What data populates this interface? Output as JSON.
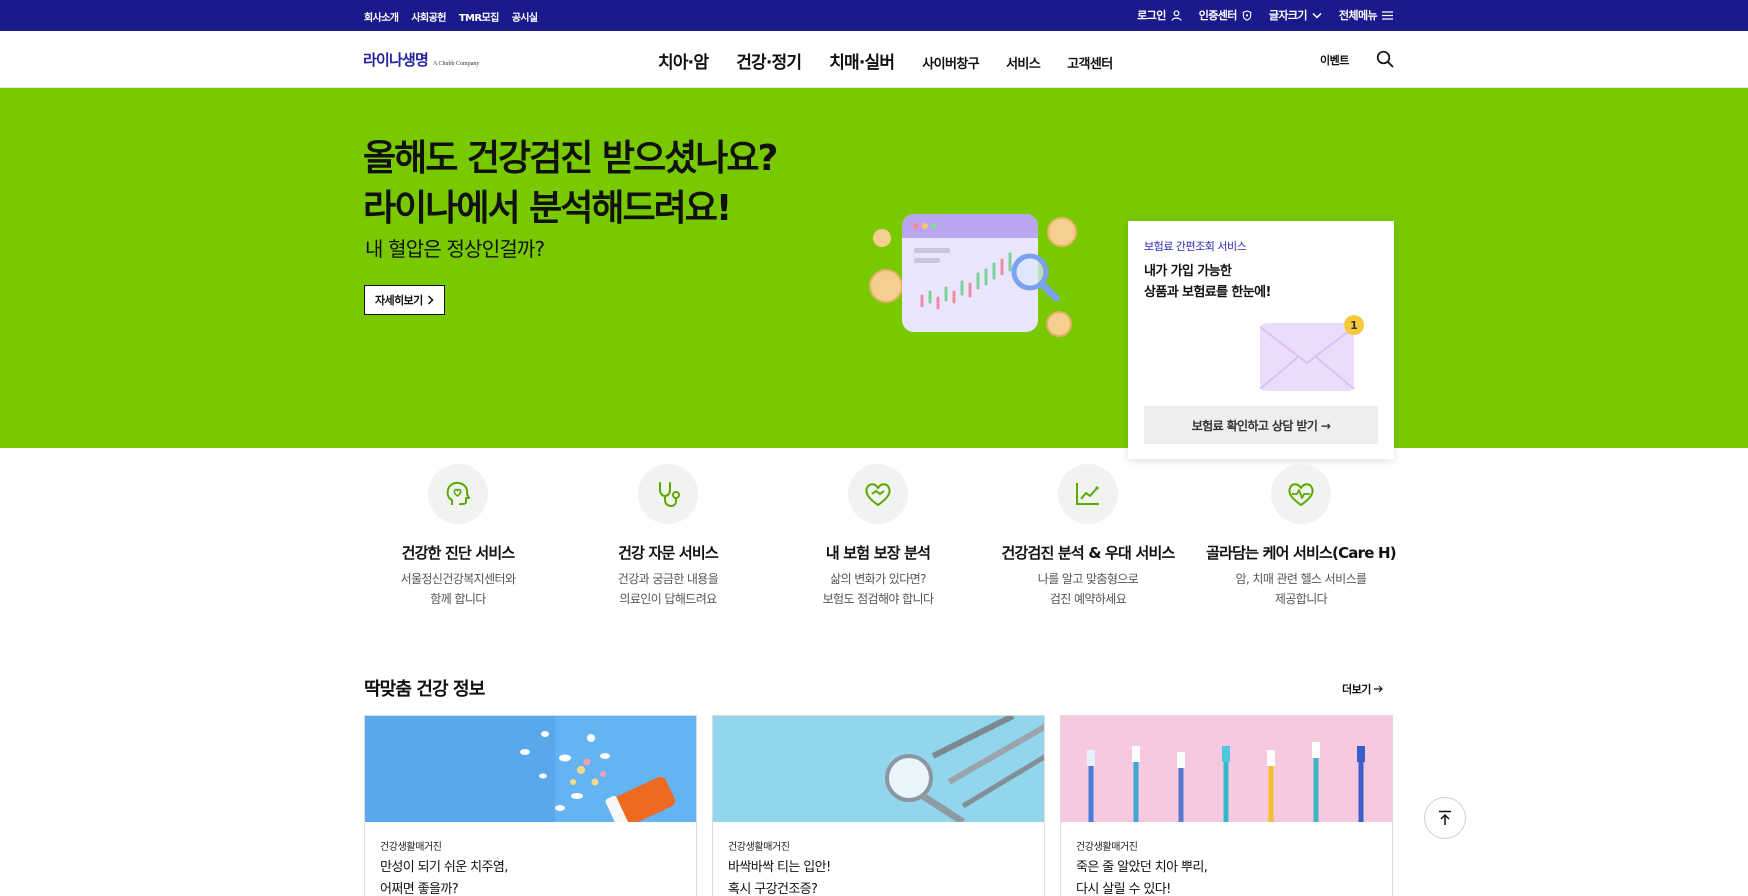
{
  "util": {
    "left_links": [
      "회사소개",
      "사회공헌",
      "TMR모집",
      "공시실"
    ],
    "login": "로그인",
    "cert_center": "인증센터",
    "font_size": "글자크기",
    "all_menu": "전체메뉴"
  },
  "header": {
    "logo_ko": "라이나생명",
    "logo_en": "A Chubb Company",
    "nav_primary": [
      "치아·암",
      "건강·정기",
      "치매·실버"
    ],
    "nav_secondary": [
      "사이버창구",
      "서비스",
      "고객센터"
    ],
    "event": "이벤트"
  },
  "hero": {
    "title_line1": "올해도 건강검진 받으셨나요?",
    "title_line2": "라이나에서 분석해드려요!",
    "subtitle": "내 혈압은 정상인걸까?",
    "button": "자세히보기"
  },
  "quote_card": {
    "kicker": "보험료 간편조회 서비스",
    "title_line1": "내가 가입 가능한",
    "title_line2": "상품과 보험료를 한눈에!",
    "badge": "1",
    "button": "보험료 확인하고 상담 받기 →"
  },
  "services": [
    {
      "title": "건강한 진단 서비스",
      "desc1": "서울정신건강복지센터와",
      "desc2": "함께 합니다",
      "icon": "head-heart-icon"
    },
    {
      "title": "건강 자문 서비스",
      "desc1": "건강과 궁금한 내용을",
      "desc2": "의료인이 답해드려요",
      "icon": "stethoscope-icon"
    },
    {
      "title": "내 보험 보장 분석",
      "desc1": "삶의 변화가 있다면?",
      "desc2": "보험도 점검해야 합니다",
      "icon": "heart-handshake-icon"
    },
    {
      "title": "건강검진 분석 & 우대 서비스",
      "desc1": "나를 알고 맞춤형으로",
      "desc2": "검진 예약하세요",
      "icon": "chart-line-icon"
    },
    {
      "title": "골라담는 케어 서비스(Care H)",
      "desc1": "암, 치매 관련 헬스 서비스를",
      "desc2": "제공합니다",
      "icon": "heart-pulse-icon"
    }
  ],
  "health_info": {
    "title": "딱맞춤 건강 정보",
    "more": "더보기",
    "cards": [
      {
        "kicker": "건강생활매거진",
        "title_line1": "만성이 되기 쉬운 치주염,",
        "title_line2": "어쩌면 좋을까?"
      },
      {
        "kicker": "건강생활매거진",
        "title_line1": "바싹바싹 티는 입안!",
        "title_line2": "혹시 구강건조증?"
      },
      {
        "kicker": "건강생활매거진",
        "title_line1": "죽은 줄 알았던 치아 뿌리,",
        "title_line2": "다시 살릴 수 있다!"
      }
    ]
  },
  "colors": {
    "util_bar": "#1b1a8d",
    "hero_bg": "#79c900",
    "brand": "#2323a0",
    "icon_green": "#5aa800"
  }
}
